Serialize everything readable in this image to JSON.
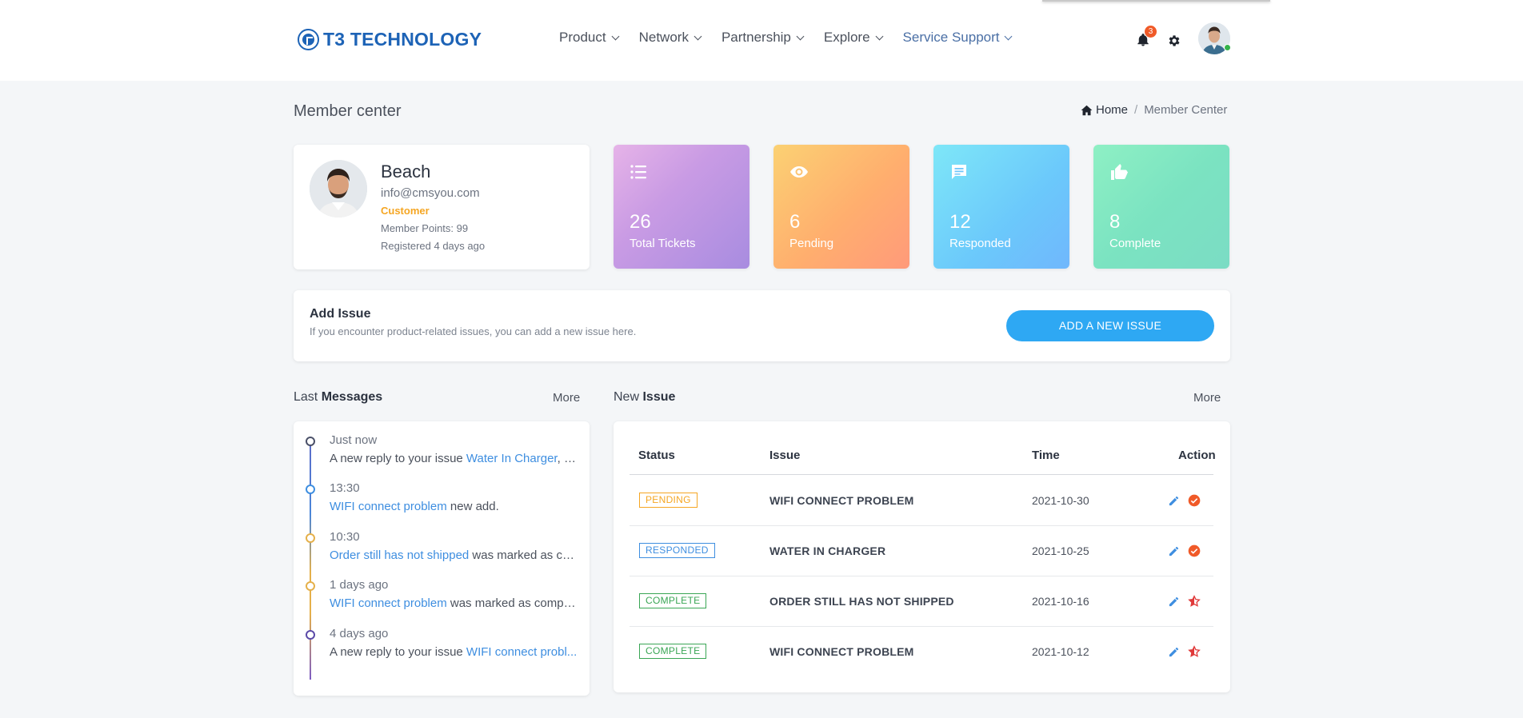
{
  "brand": {
    "name": "T3 TECHNOLOGY",
    "color": "#1d63b6"
  },
  "nav": [
    {
      "label": "Product"
    },
    {
      "label": "Network"
    },
    {
      "label": "Partnership"
    },
    {
      "label": "Explore"
    },
    {
      "label": "Service Support",
      "active": true
    }
  ],
  "notifications": {
    "count": "3",
    "icon": "bell-icon"
  },
  "page": {
    "title": "Member center"
  },
  "breadcrumb": {
    "home": "Home",
    "separator": "/",
    "current": "Member Center"
  },
  "profile": {
    "name": "Beach",
    "email": "info@cmsyou.com",
    "role": "Customer",
    "points": "Member Points: 99",
    "registered": "Registered 4 days ago"
  },
  "stats": [
    {
      "value": "26",
      "label": "Total Tickets",
      "icon": "list-icon"
    },
    {
      "value": "6",
      "label": "Pending",
      "icon": "eye-icon"
    },
    {
      "value": "12",
      "label": "Responded",
      "icon": "chat-icon"
    },
    {
      "value": "8",
      "label": "Complete",
      "icon": "thumbs-up-icon"
    }
  ],
  "add_issue": {
    "title": "Add Issue",
    "description": "If you encounter product-related issues, you can add a new issue here.",
    "button": "ADD A NEW ISSUE"
  },
  "messages": {
    "title_light": "Last",
    "title_bold": "Messages",
    "more": "More",
    "items": [
      {
        "time": "Just now",
        "prefix": "A new reply to your issue ",
        "link": "Water In Charger",
        "suffix": ", p..."
      },
      {
        "time": "13:30",
        "prefix": "",
        "link": "WIFI connect problem",
        "suffix": " new add."
      },
      {
        "time": "10:30",
        "prefix": "",
        "link": "Order still has not shipped",
        "suffix": " was marked as co..."
      },
      {
        "time": "1 days ago",
        "prefix": "",
        "link": "WIFI connect problem",
        "suffix": " was marked as comple..."
      },
      {
        "time": "4 days ago",
        "prefix": "A new reply to your issue ",
        "link": "WIFI connect probl...",
        "suffix": ""
      }
    ]
  },
  "issues": {
    "title_light": "New",
    "title_bold": "Issue",
    "more": "More",
    "columns": [
      "Status",
      "Issue",
      "Time",
      "Action"
    ],
    "rows": [
      {
        "status": "PENDING",
        "issue": "WIFI CONNECT PROBLEM",
        "time": "2021-10-30",
        "action": "check"
      },
      {
        "status": "RESPONDED",
        "issue": "WATER IN CHARGER",
        "time": "2021-10-25",
        "action": "check"
      },
      {
        "status": "COMPLETE",
        "issue": "ORDER STILL HAS NOT SHIPPED",
        "time": "2021-10-16",
        "action": "rate"
      },
      {
        "status": "COMPLETE",
        "issue": "WIFI CONNECT PROBLEM",
        "time": "2021-10-12",
        "action": "rate"
      }
    ]
  },
  "colors": {
    "accent": "#2ea8f3",
    "pending": "#f5a623",
    "responded": "#3e8ee0",
    "complete": "#3aa655",
    "action_check": "#f05a28",
    "action_rate": "#e03a3a"
  }
}
